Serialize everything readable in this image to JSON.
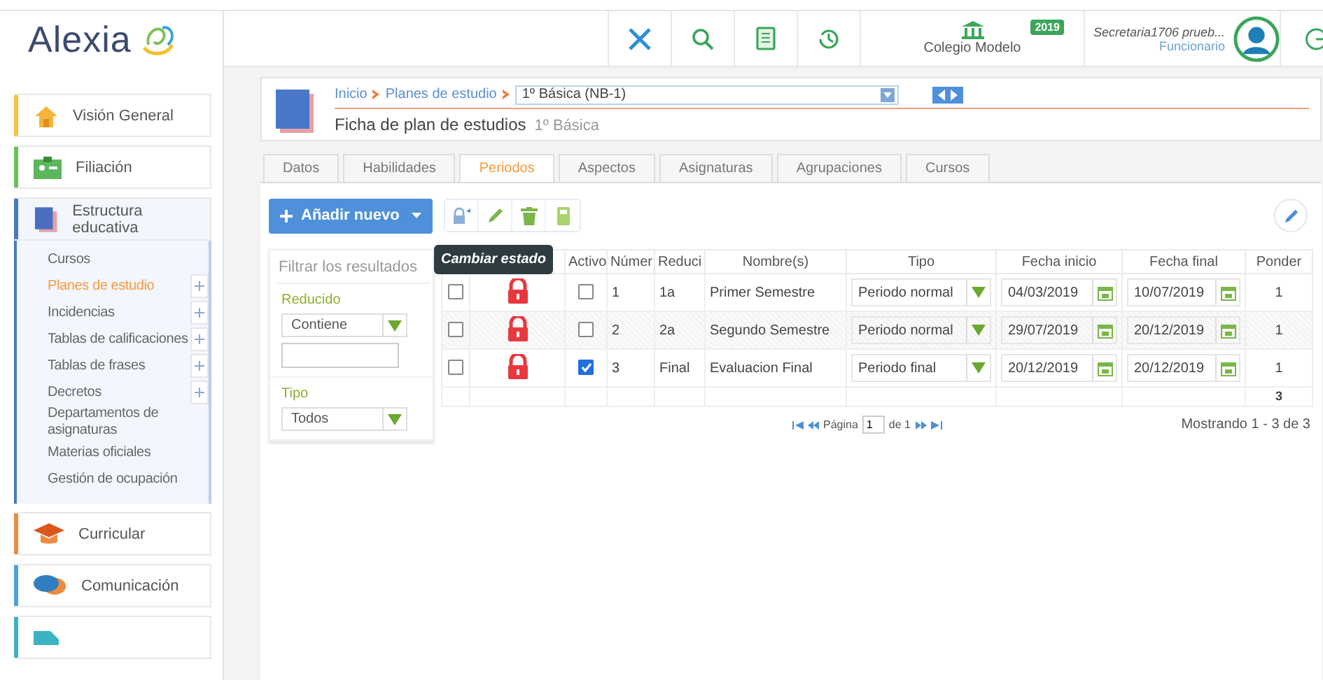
{
  "logo": {
    "text": "Alexia"
  },
  "header": {
    "school": "Colegio Modelo",
    "year": "2019",
    "user": "Secretaria1706 prueb...",
    "role": "Funcionario"
  },
  "sidebar": {
    "sections": [
      {
        "label": "Visión General",
        "kind": "home",
        "color": "#f5c242",
        "expanded": false
      },
      {
        "label": "Filiación",
        "kind": "card",
        "color": "#6bbf59",
        "expanded": false
      },
      {
        "label": "Estructura educativa",
        "kind": "book",
        "color": "#4a78c8",
        "expanded": true,
        "children": [
          {
            "label": "Cursos",
            "selected": false,
            "plus": false
          },
          {
            "label": "Planes de estudio",
            "selected": true,
            "plus": true
          },
          {
            "label": "Incidencias",
            "selected": false,
            "plus": true
          },
          {
            "label": "Tablas de calificaciones",
            "selected": false,
            "plus": true
          },
          {
            "label": "Tablas de frases",
            "selected": false,
            "plus": true
          },
          {
            "label": "Decretos",
            "selected": false,
            "plus": true
          },
          {
            "label": "Departamentos de asignaturas",
            "selected": false,
            "plus": false
          },
          {
            "label": "Materias oficiales",
            "selected": false,
            "plus": false
          },
          {
            "label": "Gestión de ocupación",
            "selected": false,
            "plus": false
          }
        ]
      },
      {
        "label": "Curricular",
        "kind": "cap",
        "color": "#f08a3c",
        "expanded": false
      },
      {
        "label": "Comunicación",
        "kind": "chat",
        "color": "#4aa3df",
        "expanded": false
      },
      {
        "kind": "doc",
        "color": "#3bb3c3",
        "expanded": false
      }
    ]
  },
  "breadcrumb": {
    "links": [
      "Inicio",
      "Planes de estudio"
    ],
    "select": "1º Básica (NB-1)",
    "title": "Ficha de plan de estudios",
    "subtitle": "1º Básica"
  },
  "tabs": [
    {
      "label": "Datos",
      "selected": false
    },
    {
      "label": "Habilidades",
      "selected": false
    },
    {
      "label": "Periodos",
      "selected": true
    },
    {
      "label": "Aspectos",
      "selected": false
    },
    {
      "label": "Asignaturas",
      "selected": false
    },
    {
      "label": "Agrupaciones",
      "selected": false
    },
    {
      "label": "Cursos",
      "selected": false
    }
  ],
  "toolbar": {
    "add_button": "Añadir nuevo",
    "tooltip": "Cambiar estado"
  },
  "filter": {
    "placeholder": "Filtrar los resultados",
    "fields": [
      {
        "label": "Reducido",
        "select": "Contiene",
        "has_input": true
      },
      {
        "label": "Tipo",
        "select": "Todos",
        "has_input": false
      }
    ]
  },
  "table": {
    "columns": [
      "Activo",
      "Númer",
      "Reduci",
      "Nombre(s)",
      "Tipo",
      "Fecha inicio",
      "Fecha final",
      "Ponder"
    ],
    "rows": [
      {
        "selected": false,
        "locked": true,
        "active": false,
        "number": "1",
        "short": "1a",
        "name": "Primer Semestre",
        "type": "Periodo normal",
        "start": "04/03/2019",
        "end": "10/07/2019",
        "weight": "1"
      },
      {
        "selected": false,
        "locked": true,
        "active": false,
        "number": "2",
        "short": "2a",
        "name": "Segundo Semestre",
        "type": "Periodo normal",
        "start": "29/07/2019",
        "end": "20/12/2019",
        "weight": "1"
      },
      {
        "selected": false,
        "locked": true,
        "active": true,
        "number": "3",
        "short": "Final",
        "name": "Evaluacion Final",
        "type": "Periodo final",
        "start": "20/12/2019",
        "end": "20/12/2019",
        "weight": "1"
      }
    ],
    "total": "3"
  },
  "pager": {
    "label": "Página",
    "page": "1",
    "of": "de 1",
    "summary": "Mostrando 1 - 3 de 3"
  }
}
